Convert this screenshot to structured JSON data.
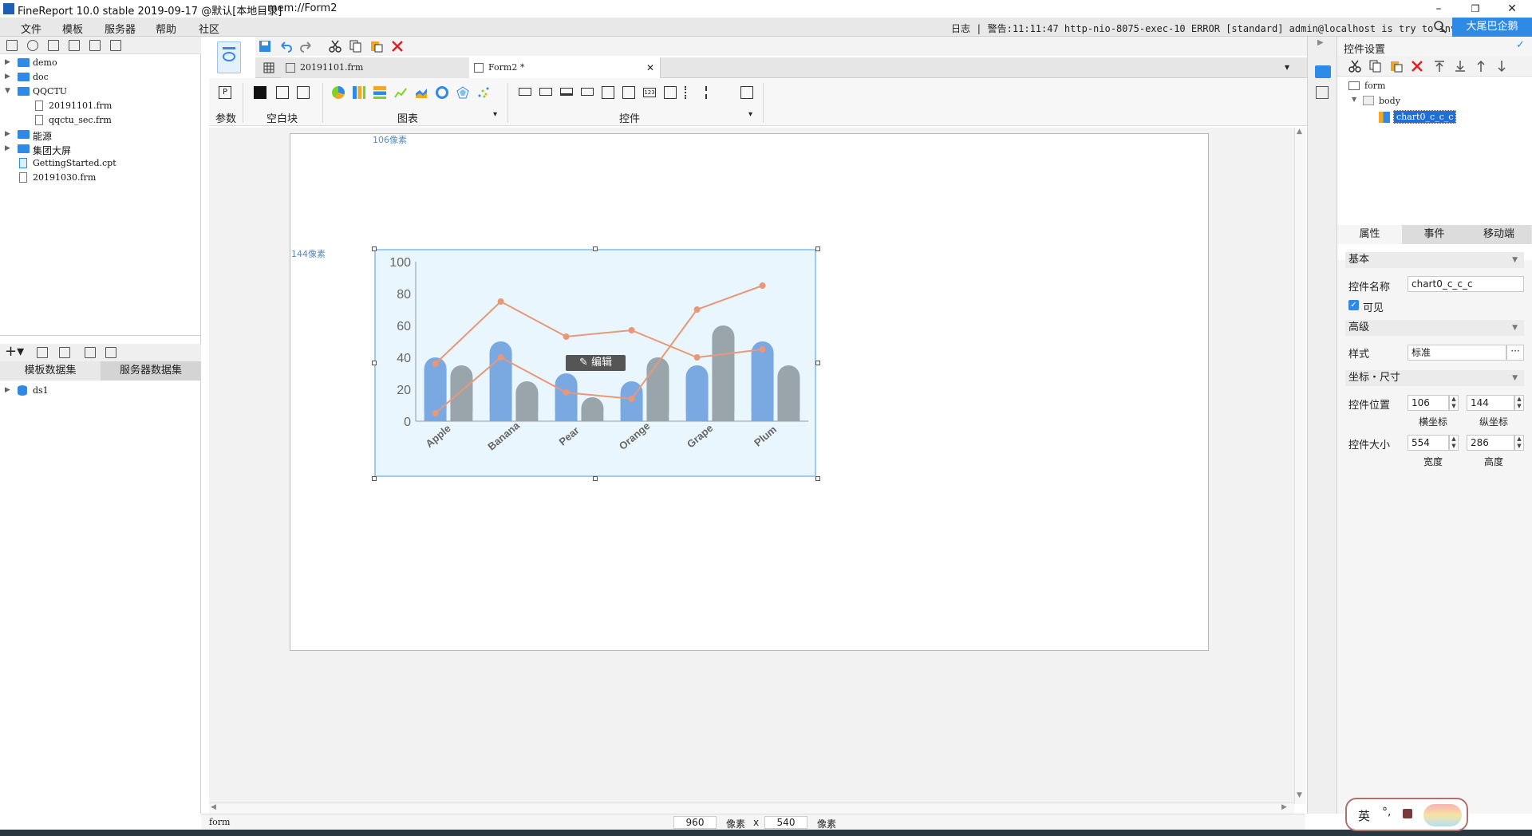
{
  "window": {
    "title": "FineReport 10.0 stable 2019-09-17 @默认[本地目录]",
    "document": "mem://Form2",
    "minimize": "–",
    "restore": "❐",
    "close": "✕"
  },
  "menu": {
    "items": [
      "文件",
      "模板",
      "服务器",
      "帮助",
      "社区"
    ],
    "log_text": "日志 | 警告:11:11:47 http-nio-8075-exec-10 ERROR [standard] admin@localhost is try to invoke rest...",
    "company": "大尾巴企鹅"
  },
  "file_tree": {
    "items": [
      {
        "label": "demo",
        "kind": "folder",
        "expanded": false,
        "depth": 0
      },
      {
        "label": "doc",
        "kind": "folder",
        "expanded": false,
        "depth": 0
      },
      {
        "label": "QQCTU",
        "kind": "folder",
        "expanded": true,
        "depth": 0
      },
      {
        "label": "20191101.frm",
        "kind": "file",
        "depth": 1
      },
      {
        "label": "qqctu_sec.frm",
        "kind": "file",
        "depth": 1
      },
      {
        "label": "能源",
        "kind": "folder",
        "expanded": false,
        "depth": 0
      },
      {
        "label": "集团大屏",
        "kind": "folder",
        "expanded": false,
        "depth": 0
      },
      {
        "label": "GettingStarted.cpt",
        "kind": "cpt",
        "depth": 0
      },
      {
        "label": "20191030.frm",
        "kind": "file",
        "depth": 0
      }
    ]
  },
  "dataset_panel": {
    "tabs": [
      "模板数据集",
      "服务器数据集"
    ],
    "active_tab": 0,
    "items": [
      "ds1"
    ]
  },
  "doc_tabs": [
    {
      "label": "20191101.frm",
      "active": false
    },
    {
      "label": "Form2 *",
      "active": true
    }
  ],
  "ribbon": {
    "groups": [
      "参数",
      "空白块",
      "图表",
      "控件"
    ]
  },
  "canvas": {
    "ruler_x_label": "106像素",
    "ruler_y_label": "144像素",
    "edit_button": "编辑"
  },
  "chart_data": {
    "type": "bar",
    "categories": [
      "Apple",
      "Banana",
      "Pear",
      "Orange",
      "Grape",
      "Plum"
    ],
    "ylim": [
      0,
      100
    ],
    "yticks": [
      "0",
      "20",
      "40",
      "60",
      "80",
      "100"
    ],
    "bar_series": [
      {
        "color": "#7aa8e0",
        "values": [
          40,
          50,
          30,
          25,
          35,
          50
        ]
      },
      {
        "color": "#9aa5ab",
        "values": [
          35,
          25,
          15,
          40,
          60,
          35
        ]
      }
    ],
    "line_series": [
      {
        "color": "#e8987a",
        "values": [
          36,
          75,
          53,
          57,
          40,
          45
        ]
      },
      {
        "color": "#e8987a",
        "values": [
          5,
          40,
          18,
          14,
          70,
          85
        ]
      }
    ]
  },
  "status": {
    "widget_name": "form",
    "width": "960",
    "unit1": "像素",
    "times": "x",
    "height": "540",
    "unit2": "像素"
  },
  "right_panel": {
    "header": "控件设置",
    "tree": {
      "root": "form",
      "child": "body",
      "leaf": "chart0_c_c_c"
    },
    "tabs": [
      "属性",
      "事件",
      "移动端"
    ],
    "active_tab": 0,
    "sections": {
      "basic": "基本",
      "advanced": "高级",
      "coords": "坐标・尺寸"
    },
    "props": {
      "name_label": "控件名称",
      "name_value": "chart0_c_c_c",
      "visible_label": "可见",
      "visible": true,
      "style_label": "样式",
      "style_value": "标准",
      "style_more": "···",
      "position_label": "控件位置",
      "pos_x": "106",
      "pos_y": "144",
      "pos_x_label": "横坐标",
      "pos_y_label": "纵坐标",
      "size_label": "控件大小",
      "width": "554",
      "height": "286",
      "width_label": "宽度",
      "height_label": "高度"
    }
  },
  "ime": {
    "lang": "英",
    "punct": "°,"
  },
  "colors": {
    "accent": "#2f8ae6",
    "selection": "#1e6fd6",
    "chart_bg": "#e9f6fd"
  }
}
